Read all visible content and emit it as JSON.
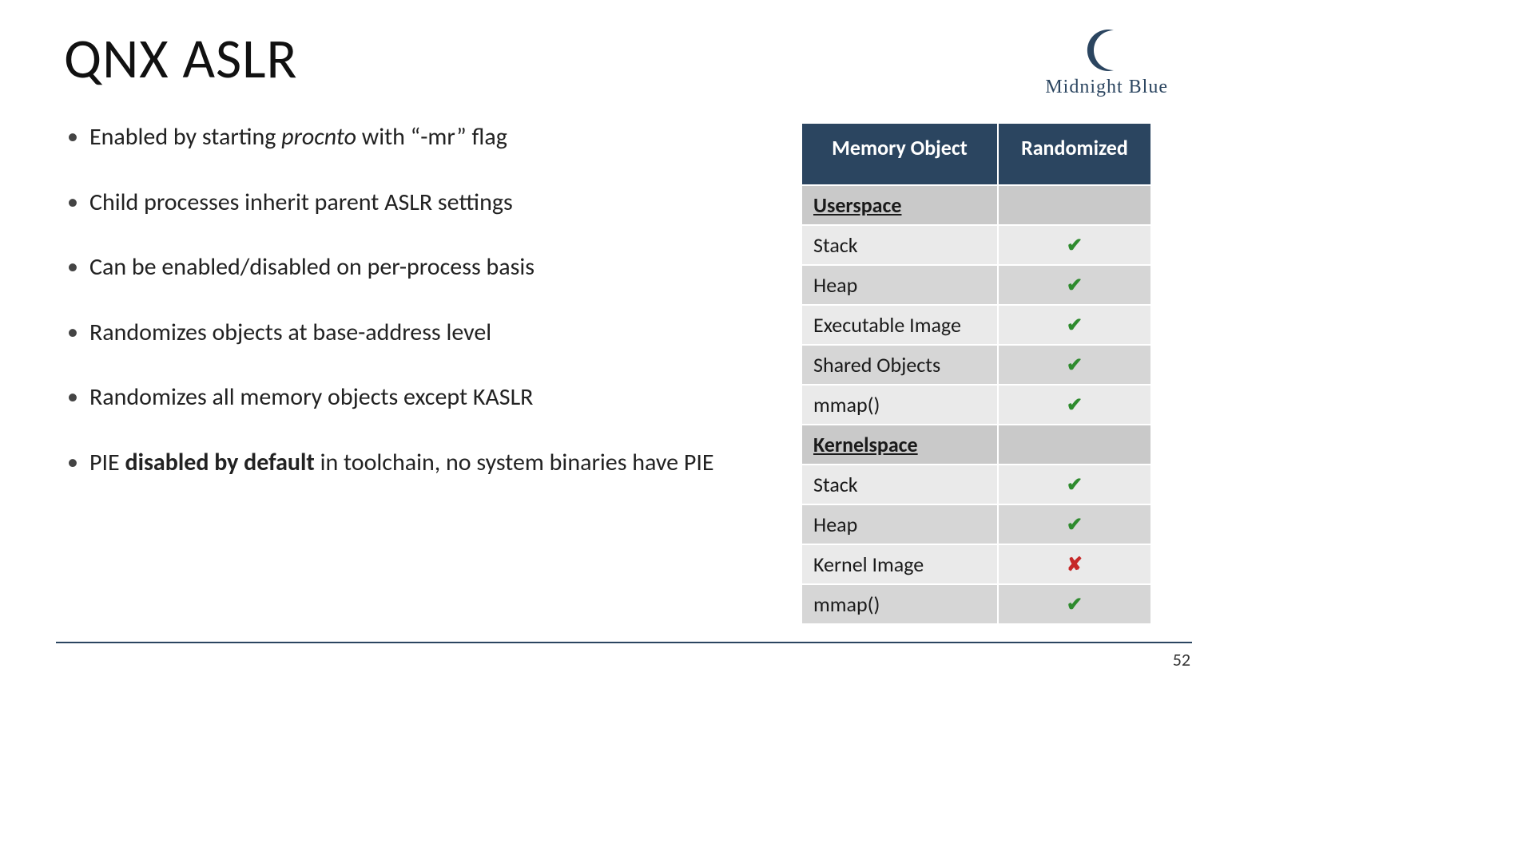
{
  "title": "QNX ASLR",
  "brand": {
    "name": "Midnight Blue",
    "color": "#2b4560"
  },
  "bullets": [
    {
      "pre": "Enabled by starting ",
      "em": "procnto",
      "post": " with  “-mr”  flag"
    },
    {
      "pre": "Child processes inherit parent ASLR settings",
      "em": "",
      "post": ""
    },
    {
      "pre": "Can be enabled/disabled on per-process basis",
      "em": "",
      "post": ""
    },
    {
      "pre": "Randomizes objects at base-address level",
      "em": "",
      "post": ""
    },
    {
      "pre": "Randomizes all memory objects except KASLR",
      "em": "",
      "post": ""
    },
    {
      "pre": "PIE ",
      "strong": "disabled by default",
      "post": " in toolchain, no system binaries have PIE"
    }
  ],
  "table": {
    "headers": [
      "Memory Object",
      "Randomized"
    ],
    "sections": [
      {
        "name": "Userspace",
        "rows": [
          {
            "label": "Stack",
            "randomized": true
          },
          {
            "label": "Heap",
            "randomized": true
          },
          {
            "label": "Executable Image",
            "randomized": true
          },
          {
            "label": "Shared Objects",
            "randomized": true
          },
          {
            "label": "mmap()",
            "randomized": true
          }
        ]
      },
      {
        "name": "Kernelspace",
        "rows": [
          {
            "label": "Stack",
            "randomized": true
          },
          {
            "label": "Heap",
            "randomized": true
          },
          {
            "label": "Kernel Image",
            "randomized": false
          },
          {
            "label": "mmap()",
            "randomized": true
          }
        ]
      }
    ]
  },
  "glyphs": {
    "check": "✔",
    "cross": "✘"
  },
  "page_number": "52"
}
